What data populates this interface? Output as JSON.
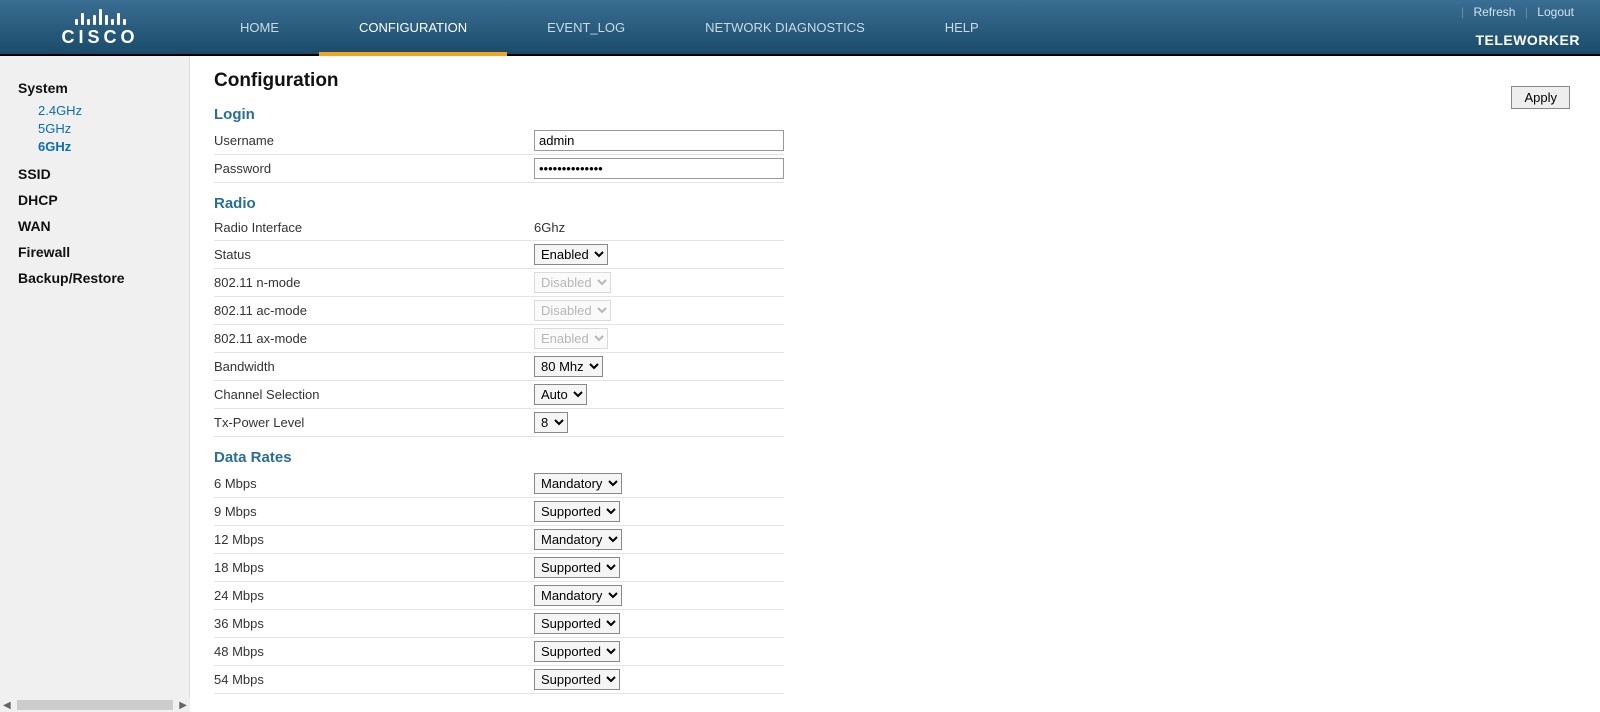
{
  "logo": {
    "text": "CISCO"
  },
  "topnav": {
    "items": [
      {
        "label": "HOME"
      },
      {
        "label": "CONFIGURATION"
      },
      {
        "label": "EVENT_LOG"
      },
      {
        "label": "NETWORK DIAGNOSTICS"
      },
      {
        "label": "HELP"
      }
    ],
    "refresh": "Refresh",
    "logout": "Logout",
    "role": "TELEWORKER"
  },
  "sidebar": {
    "system": {
      "label": "System",
      "sub": [
        {
          "label": "2.4GHz"
        },
        {
          "label": "5GHz"
        },
        {
          "label": "6GHz"
        }
      ]
    },
    "ssid": {
      "label": "SSID"
    },
    "dhcp": {
      "label": "DHCP"
    },
    "wan": {
      "label": "WAN"
    },
    "firewall": {
      "label": "Firewall"
    },
    "backup": {
      "label": "Backup/Restore"
    }
  },
  "page": {
    "title": "Configuration",
    "apply": "Apply"
  },
  "login": {
    "title": "Login",
    "username_label": "Username",
    "username_value": "admin",
    "password_label": "Password",
    "password_value": "••••••••••••••"
  },
  "radio": {
    "title": "Radio",
    "interface_label": "Radio Interface",
    "interface_value": "6Ghz",
    "status_label": "Status",
    "status_value": "Enabled",
    "nmode_label": "802.11 n-mode",
    "nmode_value": "Disabled",
    "acmode_label": "802.11 ac-mode",
    "acmode_value": "Disabled",
    "axmode_label": "802.11 ax-mode",
    "axmode_value": "Enabled",
    "bandwidth_label": "Bandwidth",
    "bandwidth_value": "80 Mhz",
    "channel_label": "Channel Selection",
    "channel_value": "Auto",
    "txpower_label": "Tx-Power Level",
    "txpower_value": "8"
  },
  "data_rates": {
    "title": "Data Rates",
    "rows": [
      {
        "label": "6 Mbps",
        "value": "Mandatory"
      },
      {
        "label": "9 Mbps",
        "value": "Supported"
      },
      {
        "label": "12 Mbps",
        "value": "Mandatory"
      },
      {
        "label": "18 Mbps",
        "value": "Supported"
      },
      {
        "label": "24 Mbps",
        "value": "Mandatory"
      },
      {
        "label": "36 Mbps",
        "value": "Supported"
      },
      {
        "label": "48 Mbps",
        "value": "Supported"
      },
      {
        "label": "54 Mbps",
        "value": "Supported"
      }
    ]
  }
}
